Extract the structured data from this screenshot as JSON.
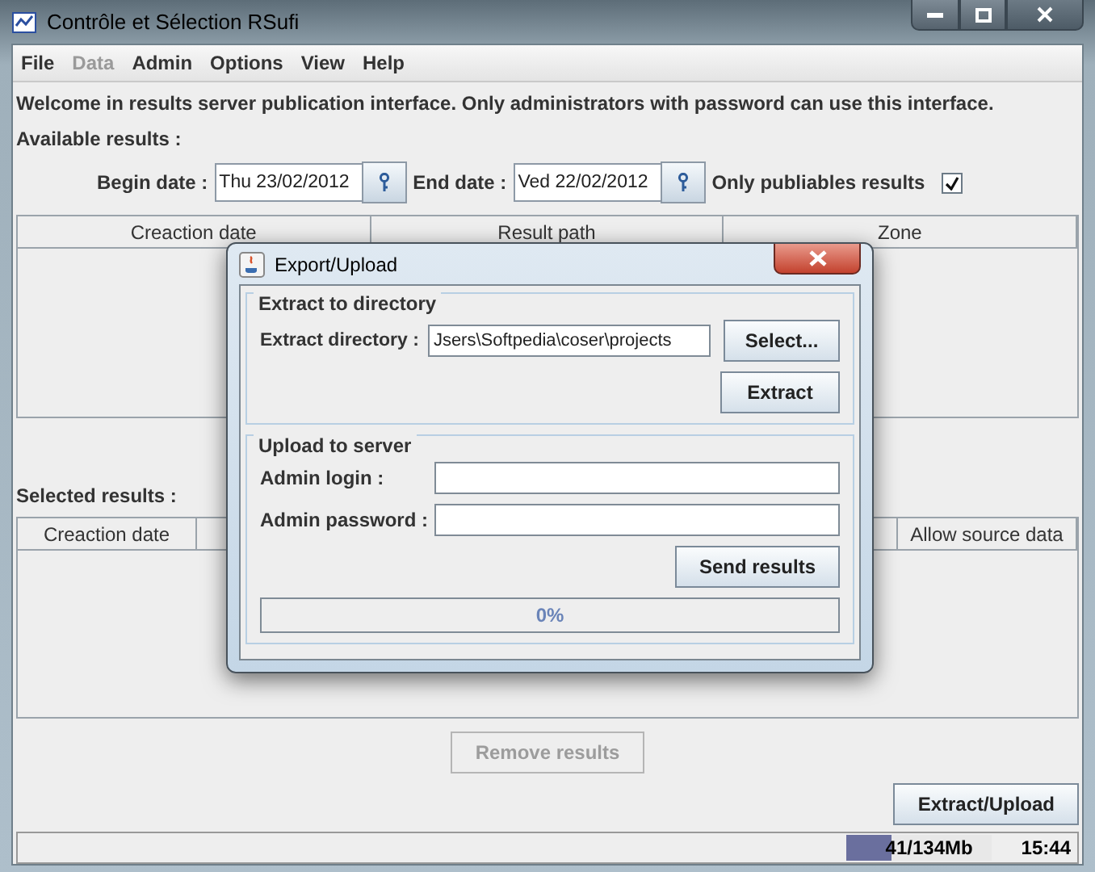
{
  "window": {
    "title": "Contrôle et Sélection RSufi"
  },
  "menu": [
    {
      "label": "File",
      "disabled": false
    },
    {
      "label": "Data",
      "disabled": true
    },
    {
      "label": "Admin",
      "disabled": false
    },
    {
      "label": "Options",
      "disabled": false
    },
    {
      "label": "View",
      "disabled": false
    },
    {
      "label": "Help",
      "disabled": false
    }
  ],
  "welcome": "Welcome in results server publication interface. Only administrators with password can use this interface.",
  "available_label": "Available results :",
  "filter": {
    "begin_label": "Begin date :",
    "begin_value": "Thu 23/02/2012",
    "end_label": "End date :",
    "end_value": "Ved 22/02/2012",
    "publiable_label": "Only publiables results",
    "publiable_checked": true
  },
  "available_table": {
    "columns": [
      "Creaction date",
      "Result path",
      "Zone"
    ]
  },
  "selected_label": "Selected results :",
  "selected_table": {
    "columns": [
      "Creaction date",
      "Allow source data"
    ]
  },
  "remove_button": {
    "label": "Remove results",
    "disabled": true
  },
  "extract_upload_button": {
    "label": "Extract/Upload",
    "disabled": false
  },
  "status_bar": {
    "memory": {
      "text": "41/134Mb",
      "level": 0.31
    },
    "time": "15:44"
  },
  "dialog": {
    "title": "Export/Upload",
    "extract_group": {
      "legend": "Extract to directory",
      "dir_label": "Extract directory :",
      "dir_value": "Jsers\\Softpedia\\coser\\projects",
      "select_button": "Select...",
      "extract_button": "Extract"
    },
    "upload_group": {
      "legend": "Upload to server",
      "login_label": "Admin login :",
      "password_label": "Admin password :",
      "send_button": "Send results",
      "progress": {
        "text": "0%",
        "level": 0
      }
    }
  }
}
